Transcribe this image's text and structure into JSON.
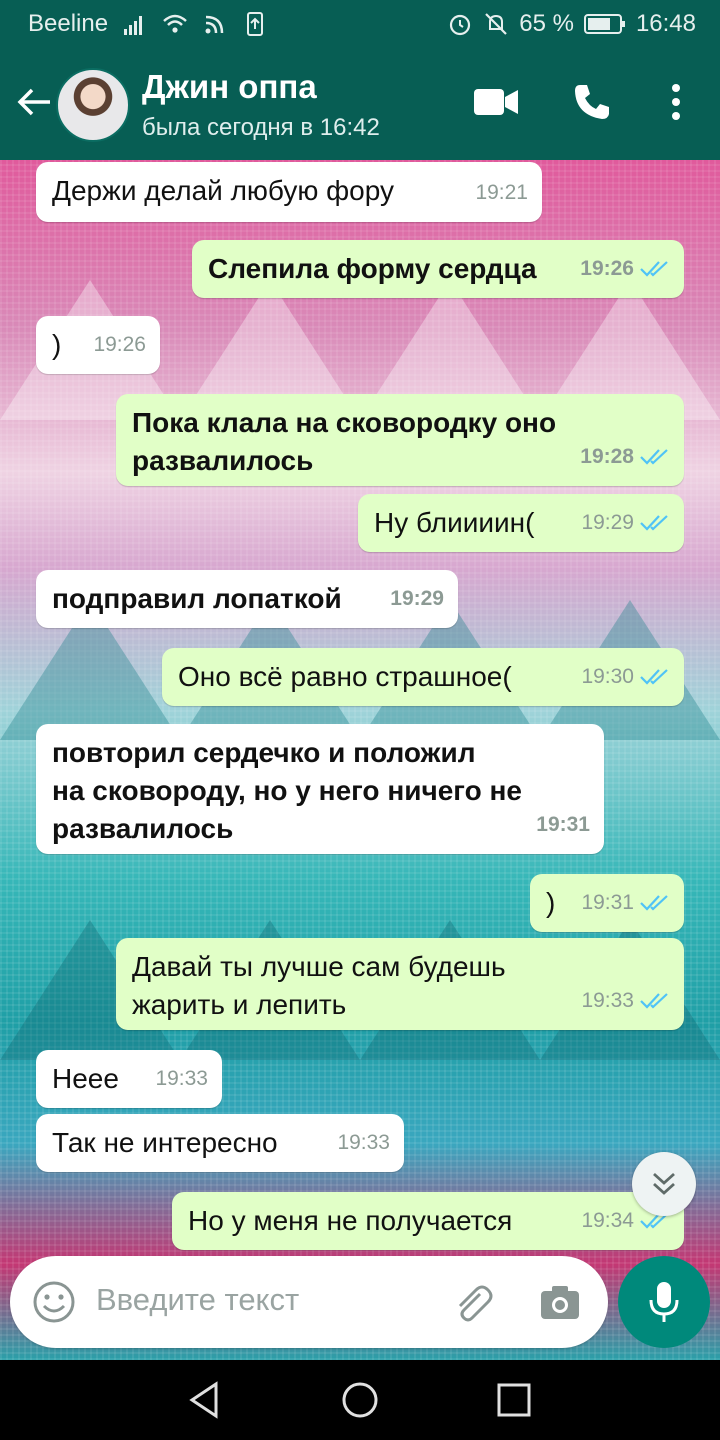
{
  "status": {
    "carrier": "Beeline",
    "battery": "65 %",
    "clock": "16:48"
  },
  "header": {
    "contact_name": "Джин оппа",
    "last_seen": "была сегодня в 16:42"
  },
  "messages": [
    {
      "dir": "in",
      "bold": false,
      "text": "Держи делай любую фору",
      "time": "19:21",
      "read": false
    },
    {
      "dir": "out",
      "bold": true,
      "text": "Слепила форму сердца",
      "time": "19:26",
      "read": true
    },
    {
      "dir": "in",
      "bold": false,
      "text": ")",
      "time": "19:26",
      "read": false
    },
    {
      "dir": "out",
      "bold": true,
      "lines": [
        "Пока клала на сковородку оно",
        "развалилось"
      ],
      "time": "19:28",
      "read": true
    },
    {
      "dir": "out",
      "bold": false,
      "text": "Ну блиииин(",
      "time": "19:29",
      "read": true
    },
    {
      "dir": "in",
      "bold": true,
      "text": "подправил лопаткой",
      "time": "19:29",
      "read": false
    },
    {
      "dir": "out",
      "bold": false,
      "text": "Оно всё равно страшное(",
      "time": "19:30",
      "read": true
    },
    {
      "dir": "in",
      "bold": true,
      "lines": [
        "повторил сердечко и положил",
        "на сковороду, но у него ничего не",
        "развалилось"
      ],
      "time": "19:31",
      "read": false
    },
    {
      "dir": "out",
      "bold": false,
      "text": ")",
      "time": "19:31",
      "read": true
    },
    {
      "dir": "out",
      "bold": false,
      "lines": [
        "Давай ты лучше сам будешь",
        "жарить и лепить"
      ],
      "time": "19:33",
      "read": true
    },
    {
      "dir": "in",
      "bold": false,
      "text": "Неее",
      "time": "19:33",
      "read": false
    },
    {
      "dir": "in",
      "bold": false,
      "text": "Так не интересно",
      "time": "19:33",
      "read": false
    },
    {
      "dir": "out",
      "bold": false,
      "text": "Но у меня не получается",
      "time": "19:34",
      "read": true
    }
  ],
  "input": {
    "placeholder": "Введите текст"
  },
  "colors": {
    "header": "#075e54",
    "incoming": "#ffffff",
    "outgoing": "#e1ffc7",
    "tick": "#4fc3f7",
    "mic": "#00897b"
  }
}
